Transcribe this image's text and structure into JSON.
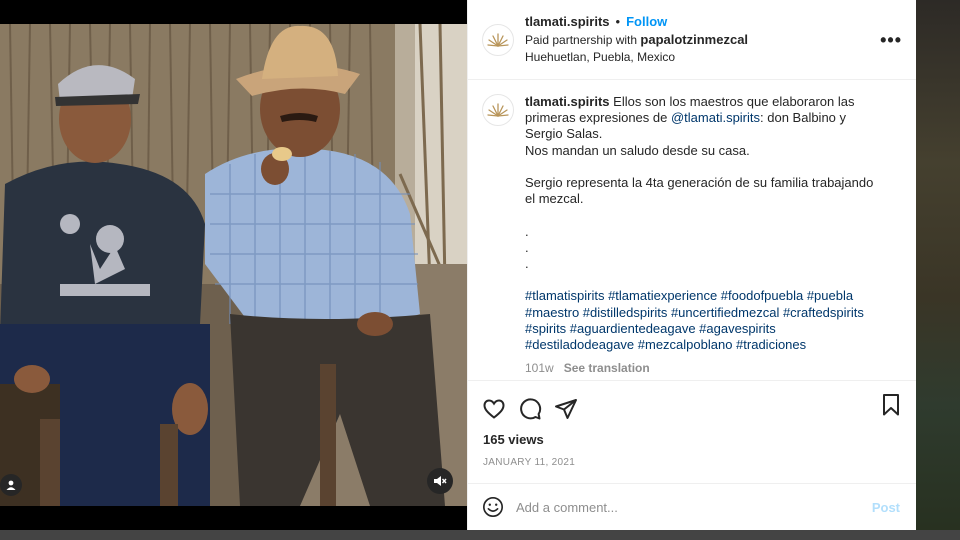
{
  "post": {
    "username": "tlamati.spirits",
    "follow_label": "Follow",
    "partnership_prefix": "Paid partnership with ",
    "partner": "papalotzinmezcal",
    "location": "Huehuetlan, Puebla, Mexico",
    "more_label": "•••"
  },
  "caption": {
    "username": "tlamati.spirits",
    "text_before_mention": " Ellos son los maestros que elaboraron las primeras expresiones de ",
    "mention": "@tlamati.spirits",
    "text_after_mention": ": don Balbino y Sergio Salas.\nNos mandan un saludo desde su casa.\n\nSergio representa la 4ta generación de su familia trabajando el mezcal.\n\n.\n.\n.\n\n",
    "hashtags": "#tlamatispirits #tlamatiexperience #foodofpuebla #puebla #maestro #distilledspirits #uncertifiedmezcal #craftedspirits #spirits #aguardientedeagave #agavespirits #destiladodeagave #mezcalpoblano #tradiciones",
    "age": "101w",
    "see_translation": "See translation"
  },
  "stats": {
    "views": "165 views",
    "date": "JANUARY 11, 2021"
  },
  "comment": {
    "placeholder": "Add a comment...",
    "post_label": "Post"
  },
  "colors": {
    "accent": "#0095f6",
    "link": "#00376b",
    "muted": "#8e8e8e",
    "post_disabled": "#b2dffc"
  },
  "icons": {
    "like": "heart-icon",
    "comment": "comment-icon",
    "share": "share-icon",
    "save": "bookmark-icon",
    "emoji": "emoji-icon",
    "sound": "mute-icon",
    "tags": "user-tag-icon"
  }
}
